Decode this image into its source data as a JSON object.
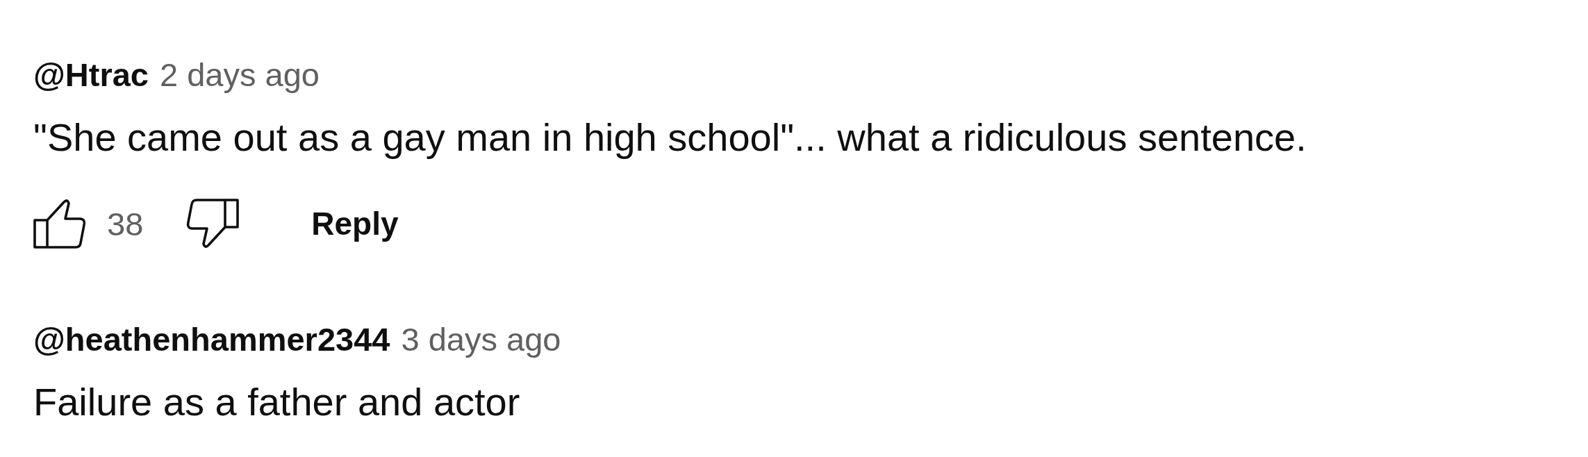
{
  "comments": [
    {
      "author": "@Htrac",
      "time": "2 days ago",
      "text": "\"She came out as a gay man in high school\"... what a ridiculous sentence.",
      "likes": "38",
      "reply": "Reply"
    },
    {
      "author": "@heathenhammer2344",
      "time": "3 days ago",
      "text": "Failure as a father and actor"
    }
  ]
}
